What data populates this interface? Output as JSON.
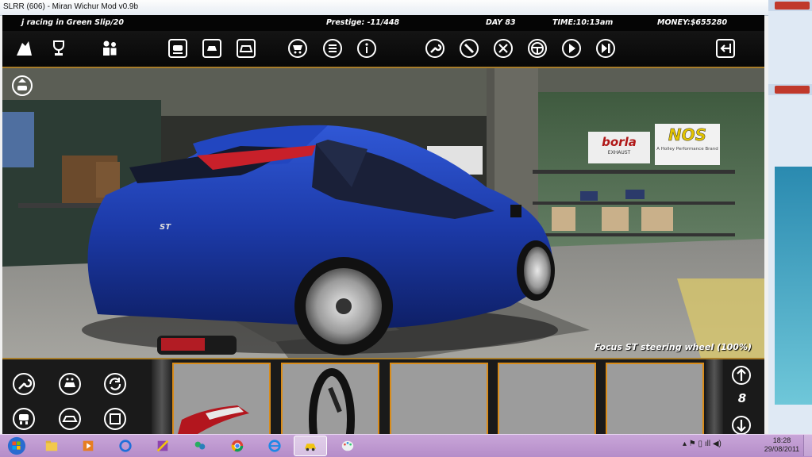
{
  "window": {
    "title": "SLRR (606) - Miran Wichur Mod v0.9b"
  },
  "status": {
    "racing": "j racing in Green Slip/20",
    "prestige": "Prestige: -11/448",
    "day": "DAY 83",
    "time": "TIME:10:13am",
    "money": "MONEY:$655280"
  },
  "toolbar": {
    "icons": [
      "garage-home-icon",
      "trophy-icon",
      "people-icon",
      "car-list-icon",
      "car-front-icon",
      "car-paint-icon",
      "shop-cart-icon",
      "list-icon",
      "info-icon",
      "wrench-icon",
      "screwdriver-icon",
      "tools-icon",
      "steering-wheel-icon",
      "play-icon",
      "skip-icon",
      "exit-icon"
    ]
  },
  "scene": {
    "caption": "Focus ST steering wheel (100%)",
    "sign_brand_1": "borla",
    "sign_brand_1_sub": "EXHAUST",
    "sign_brand_2": "NOS",
    "sign_brand_2_sub": "A Holley Performance Brand",
    "badge": "ST"
  },
  "bottom": {
    "page_number": "8",
    "left_icons": [
      "wrench-icon",
      "car-wash-icon",
      "refresh-icon",
      "car-lift-icon",
      "car-top-icon",
      "frame-icon"
    ]
  },
  "taskbar": {
    "time": "18:28",
    "date": "29/08/2011"
  },
  "colors": {
    "accent": "#d98c1a",
    "car": "#1c3aa8"
  }
}
